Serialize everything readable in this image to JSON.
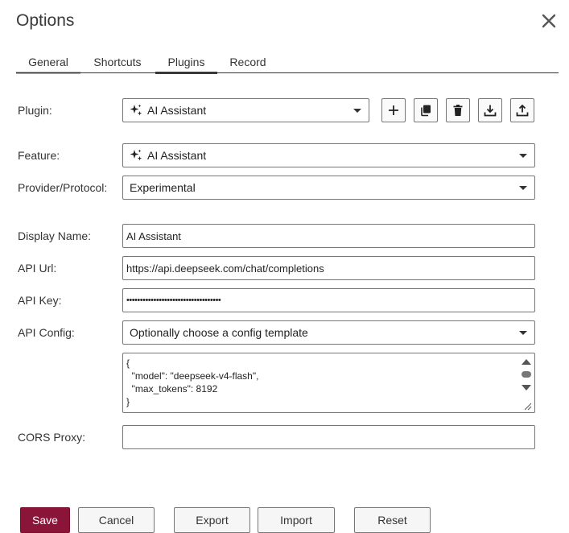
{
  "colors": {
    "accent": "#8b1538",
    "accent_soft": "#d59aa8"
  },
  "dialog": {
    "title": "Options"
  },
  "tabs": [
    {
      "label": "General"
    },
    {
      "label": "Shortcuts"
    },
    {
      "label": "Plugins",
      "selected": true
    },
    {
      "label": "Record"
    }
  ],
  "plugin": {
    "label": "Plugin:",
    "value": "AI Assistant",
    "icons": [
      "plus-icon",
      "copy-icon",
      "trash-icon",
      "download-icon",
      "upload-icon"
    ]
  },
  "feature": {
    "label": "Feature:",
    "value": "AI Assistant"
  },
  "provider": {
    "label": "Provider/Protocol:",
    "value": "Experimental"
  },
  "display_name": {
    "label": "Display Name:",
    "value": "AI Assistant"
  },
  "api_url": {
    "label": "API Url:",
    "value": "https://api.deepseek.com/chat/completions"
  },
  "api_key": {
    "label": "API Key:",
    "value": "•••••••••••••••••••••••••••••••••••"
  },
  "api_config": {
    "label": "API Config:",
    "placeholder": "Optionally choose a config template",
    "json": "{\n  \"model\": \"deepseek-v4-flash\",\n  \"max_tokens\": 8192\n}"
  },
  "cors_proxy": {
    "label": "CORS Proxy:",
    "value": ""
  },
  "footer": {
    "save": "Save",
    "cancel": "Cancel",
    "export": "Export",
    "import": "Import",
    "reset": "Reset"
  }
}
